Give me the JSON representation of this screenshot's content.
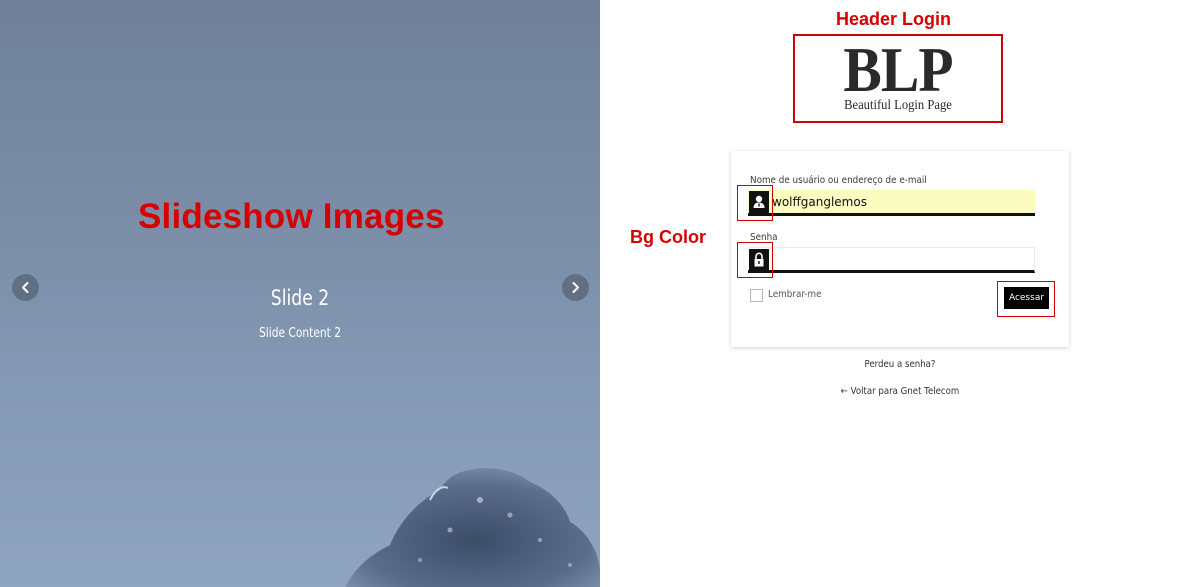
{
  "slideshow": {
    "annotation": "Slideshow Images",
    "slide_title": "Slide 2",
    "slide_content": "Slide Content 2",
    "prev_icon": "chevron-left-icon",
    "next_icon": "chevron-right-icon"
  },
  "annotations": {
    "header_login": "Header Login",
    "bg_color": "Bg Color"
  },
  "logo": {
    "title": "BLP",
    "subtitle": "Beautiful Login Page"
  },
  "login_form": {
    "username_label": "Nome de usuário ou endereço de e-mail",
    "username_value": "wolffganglemos",
    "username_icon": "user-icon",
    "password_label": "Senha",
    "password_value": "",
    "password_icon": "lock-icon",
    "remember_label": "Lembrar-me",
    "submit_label": "Acessar"
  },
  "links": {
    "lost_password": "Perdeu a senha?",
    "back_to_site": "← Voltar para Gnet Telecom"
  },
  "colors": {
    "annotation_red": "#d60000",
    "input_autofill_bg": "#fafcc0",
    "button_bg": "#000000"
  }
}
